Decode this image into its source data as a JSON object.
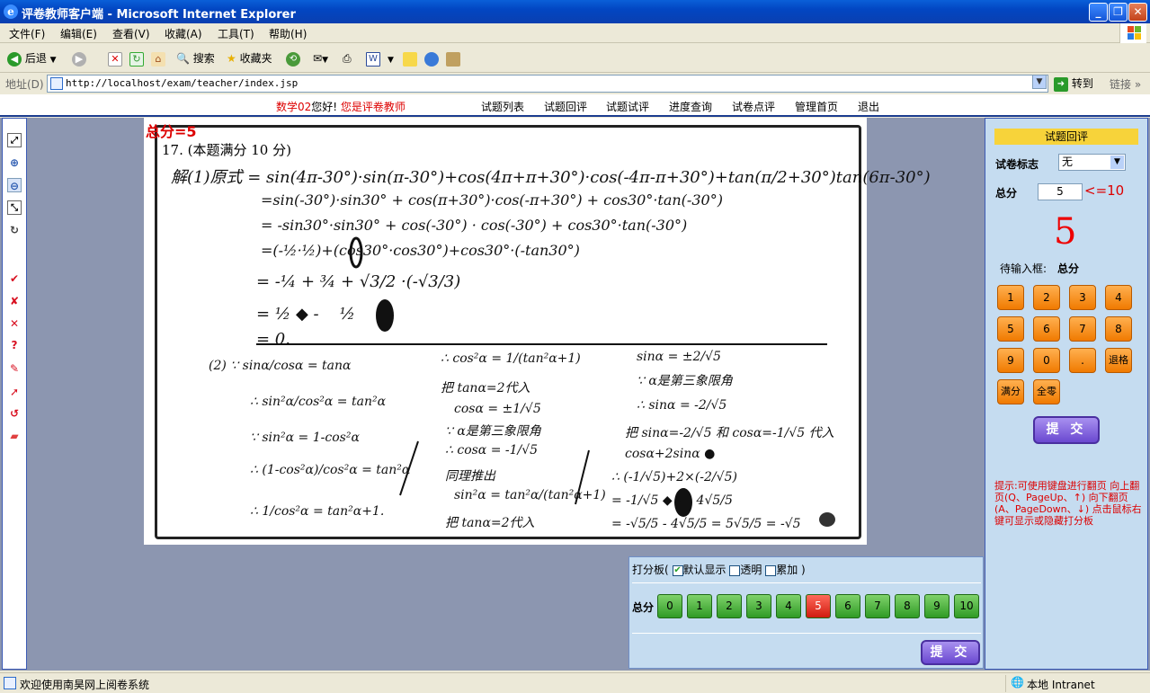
{
  "window": {
    "title": "评卷教师客户端 - Microsoft Internet Explorer",
    "min": "_",
    "max": "❐",
    "close": "✕"
  },
  "menu": [
    "文件(F)",
    "编辑(E)",
    "查看(V)",
    "收藏(A)",
    "工具(T)",
    "帮助(H)"
  ],
  "toolbar": {
    "back": "后退",
    "search": "搜索",
    "favorites": "收藏夹"
  },
  "address": {
    "label": "地址(D)",
    "url": "http://localhost/exam/teacher/index.jsp",
    "go": "转到",
    "links": "链接"
  },
  "nav": {
    "user": "数学02",
    "greeting": "您好!",
    "role": "您是评卷教师",
    "links": [
      "试题列表",
      "试题回评",
      "试题试评",
      "进度查询",
      "试卷点评",
      "管理首页",
      "退出"
    ]
  },
  "paper": {
    "total_label": "总分=5",
    "question_header": "17. (本题满分 10 分)"
  },
  "scorepad": {
    "label_prefix": "打分板(",
    "opt_default": "默认显示",
    "opt_default_checked": true,
    "opt_transparent": "透明",
    "opt_cumulative": "累加",
    "label_suffix": ")",
    "row_label": "总分",
    "buttons": [
      "0",
      "1",
      "2",
      "3",
      "4",
      "5",
      "6",
      "7",
      "8",
      "9",
      "10"
    ],
    "selected": "5",
    "submit": "提 交"
  },
  "panel": {
    "title": "试题回评",
    "flag_label": "试卷标志",
    "flag_value": "无",
    "total_label": "总分",
    "total_value": "5",
    "limit": "<=10",
    "big_score": "5",
    "pending_label": "待输入框:",
    "pending_value": "总分",
    "keys": [
      "1",
      "2",
      "3",
      "4",
      "5",
      "6",
      "7",
      "8",
      "9",
      "0",
      ".",
      "退格"
    ],
    "full": "满分",
    "zero": "全零",
    "submit": "提 交",
    "hint": "提示:可使用键盘进行翻页 向上翻页(Q、PageUp、↑) 向下翻页(A、PageDown、↓) 点击鼠标右键可显示或隐藏打分板"
  },
  "status": {
    "left": "欢迎使用南昊网上阅卷系统",
    "right": "本地 Intranet"
  }
}
